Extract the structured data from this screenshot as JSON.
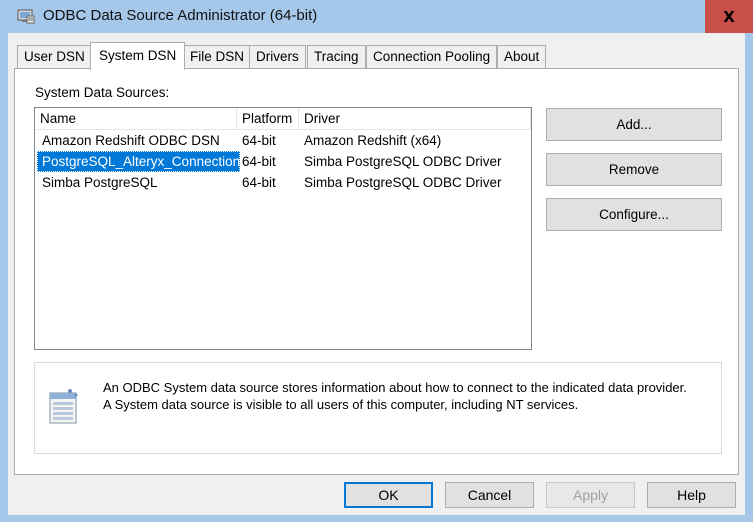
{
  "window": {
    "title": "ODBC Data Source Administrator (64-bit)",
    "close_label": "X",
    "icon": "odbc-admin-icon"
  },
  "tabs": [
    {
      "label": "User DSN"
    },
    {
      "label": "System DSN",
      "active": true
    },
    {
      "label": "File DSN"
    },
    {
      "label": "Drivers"
    },
    {
      "label": "Tracing"
    },
    {
      "label": "Connection Pooling"
    },
    {
      "label": "About"
    }
  ],
  "system_dsn": {
    "group_label": "System Data Sources:",
    "columns": [
      "Name",
      "Platform",
      "Driver"
    ],
    "rows": [
      {
        "name": "Amazon Redshift ODBC DSN",
        "platform": "64-bit",
        "driver": "Amazon Redshift (x64)"
      },
      {
        "name": "PostgreSQL_Alteryx_Connection",
        "platform": "64-bit",
        "driver": "Simba PostgreSQL ODBC Driver",
        "selected": true
      },
      {
        "name": "Simba PostgreSQL",
        "platform": "64-bit",
        "driver": "Simba PostgreSQL ODBC Driver"
      }
    ],
    "buttons": {
      "add": "Add...",
      "remove": "Remove",
      "configure": "Configure..."
    },
    "info": {
      "icon": "data-source-info-icon",
      "line1": "An ODBC System data source stores information about how to connect to the indicated data provider.",
      "line2": "A System data source is visible to all users of this computer, including NT services."
    }
  },
  "dialog_buttons": {
    "ok": "OK",
    "cancel": "Cancel",
    "apply": "Apply",
    "help": "Help"
  },
  "colors": {
    "titlebar": "#a5c7ea",
    "close": "#c9504a",
    "selection": "#0078d7"
  }
}
